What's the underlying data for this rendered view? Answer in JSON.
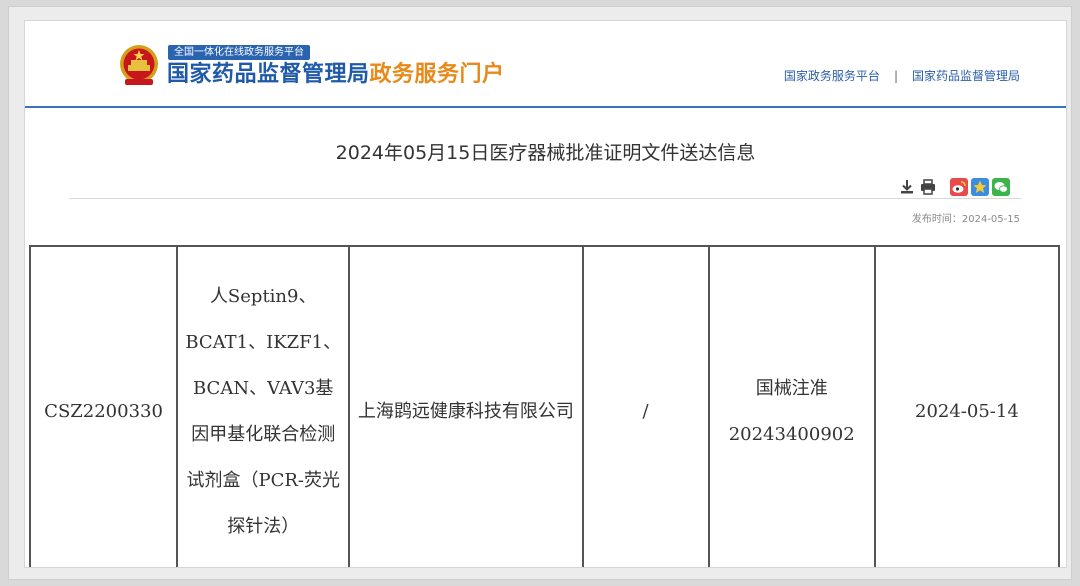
{
  "header": {
    "tag_line": "全国一体化在线政务服务平台",
    "title_blue": "国家药品监督管理局",
    "title_orange": "政务服务门户",
    "nav": [
      {
        "label": "国家政务服务平台"
      },
      {
        "label": "国家药品监督管理局"
      }
    ],
    "nav_separator": "|"
  },
  "article": {
    "title": "2024年05月15日医疗器械批准证明文件送达信息",
    "date_label": "发布时间：",
    "date_value": "2024-05-15"
  },
  "tools": {
    "icons": [
      "download-icon",
      "print-icon",
      "weibo-icon",
      "qzone-icon",
      "wechat-icon"
    ]
  },
  "table": {
    "rows": [
      {
        "acceptance_no": "CSZ2200330",
        "product_name": "人Septin9、BCAT1、IKZF1、BCAN、VAV3基因甲基化联合检测试剂盒（PCR-荧光探针法）",
        "applicant": "上海鹍远健康科技有限公司",
        "blank": "/",
        "registration_no": "国械注准20243400902",
        "date": "2024-05-14"
      }
    ]
  },
  "colors": {
    "brand_blue": "#1f5aa8",
    "brand_orange": "#e88a1a",
    "rule_blue": "#3b74b8"
  }
}
